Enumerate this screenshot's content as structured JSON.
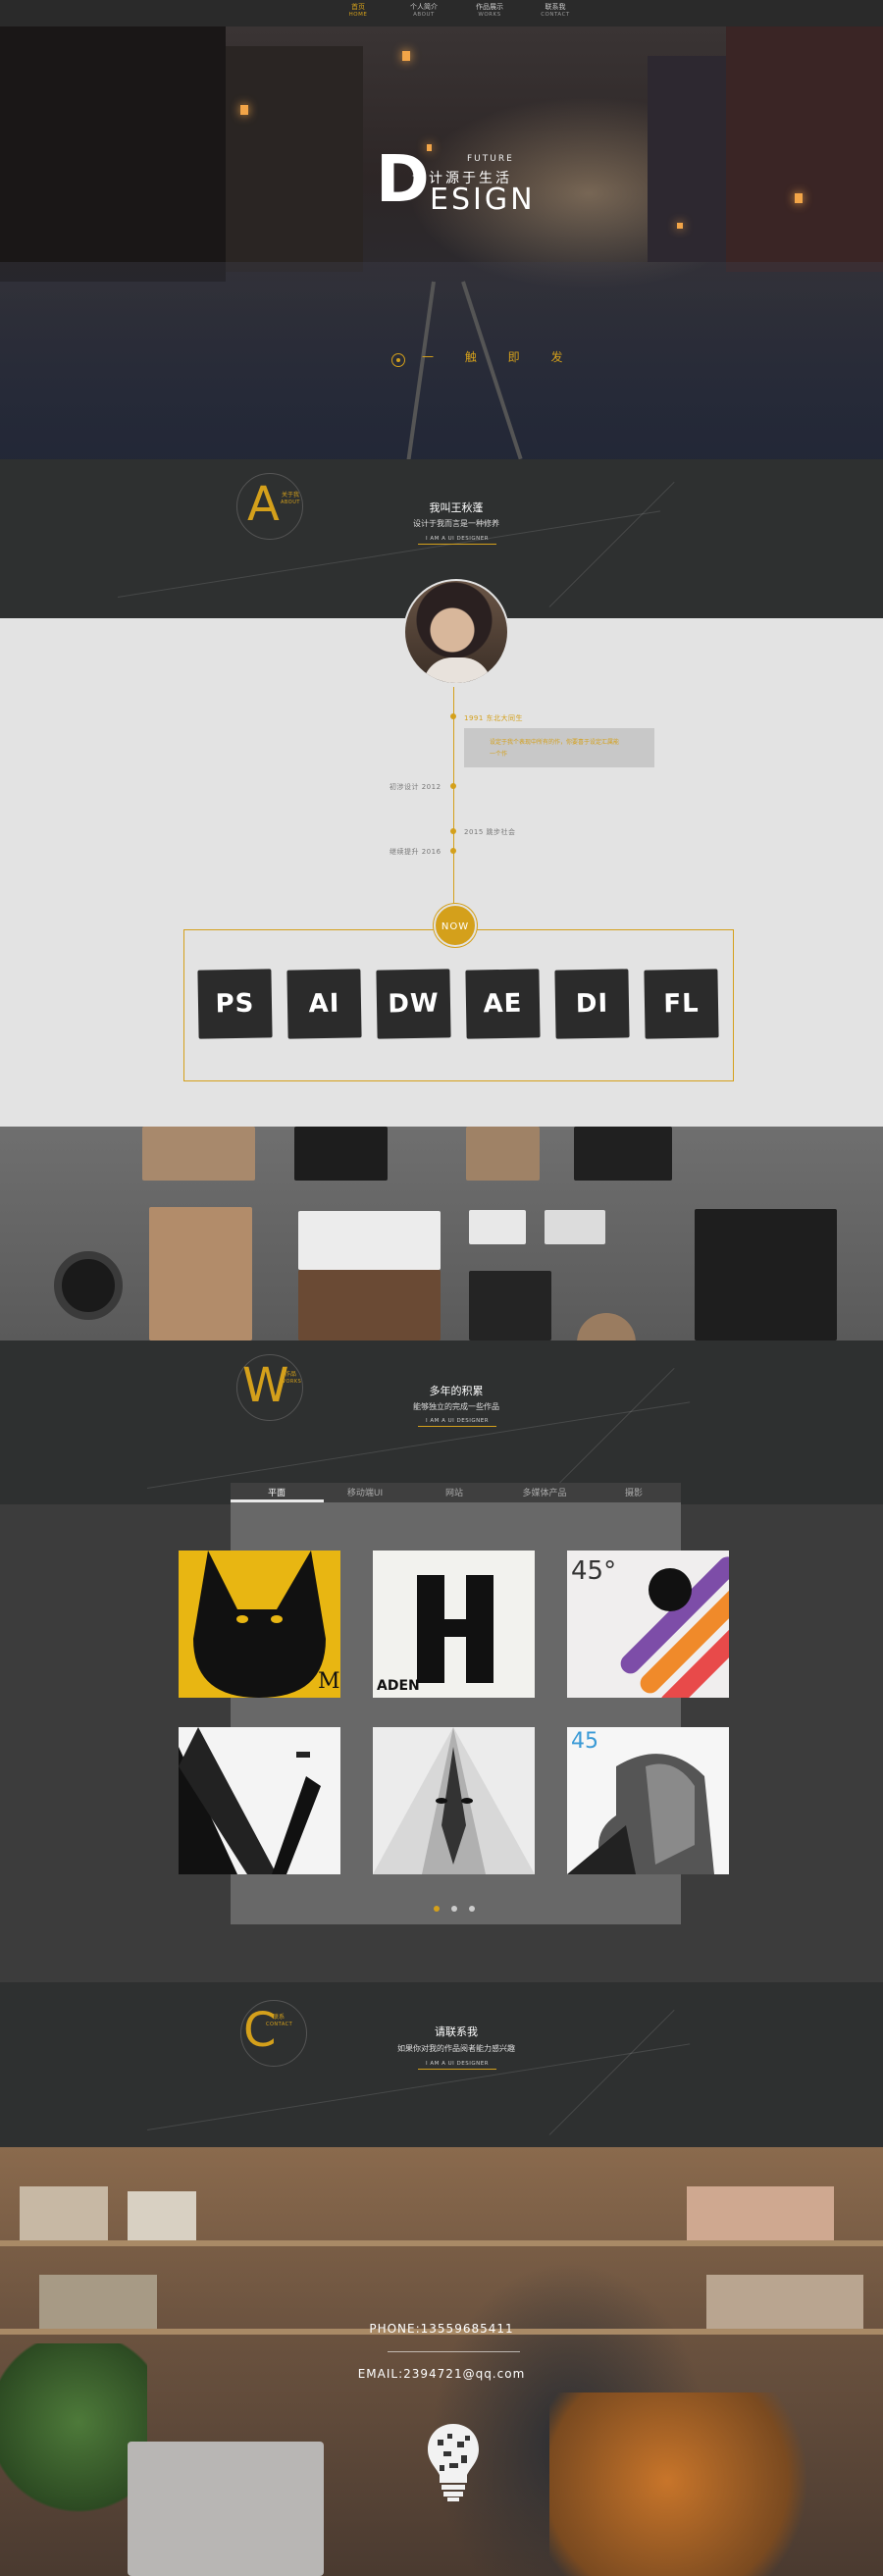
{
  "nav": {
    "items": [
      {
        "cn": "首页",
        "en": "HOME",
        "active": true
      },
      {
        "cn": "个人简介",
        "en": "ABOUT",
        "active": false
      },
      {
        "cn": "作品展示",
        "en": "WORKS",
        "active": false
      },
      {
        "cn": "联系我",
        "en": "CONTACT",
        "active": false
      }
    ]
  },
  "hero": {
    "logo_d": "D",
    "logo_future": "FUTURE",
    "logo_cn": "设计源于生活",
    "logo_design": "ESIGN",
    "slogan": "一 触 即 发"
  },
  "about_header": {
    "letter": "A",
    "mini_cn": "关于我",
    "mini_en": "ABOUT",
    "title": "我叫王秋蓬",
    "subtitle": "设计于我而言是一种修养",
    "tag": "I AM A UI DESIGNER"
  },
  "timeline": {
    "entries": [
      {
        "label": "1991  东北大同生",
        "side": "right"
      },
      {
        "label": "初涉设计    2012",
        "side": "left"
      },
      {
        "label": "2015  跳步社会",
        "side": "right"
      },
      {
        "label": "继续提升    2016",
        "side": "left"
      }
    ],
    "box_text": "设定于我个表现中所有的作，你要喜于设定汇属能",
    "box_text2": "一个作",
    "now": "NOW"
  },
  "skills": [
    "PS",
    "AI",
    "DW",
    "AE",
    "DI",
    "FL"
  ],
  "works_header": {
    "letter": "W",
    "mini_cn": "作品",
    "mini_en": "WORKS",
    "title": "多年的积累",
    "subtitle": "能够独立的完成一些作品",
    "tag": "I AM A UI DESIGNER"
  },
  "works": {
    "tabs": [
      "平面",
      "移动端UI",
      "网站",
      "多媒体产品",
      "摄影"
    ],
    "active_tab": 0,
    "thumbs": [
      {
        "name": "yellow-cat-poster",
        "text": ""
      },
      {
        "name": "letter-h-poster",
        "text": "ADEN"
      },
      {
        "name": "45-degree-poster",
        "text": "45°"
      },
      {
        "name": "helicopter-lines-poster",
        "text": ""
      },
      {
        "name": "wolf-face-poster",
        "text": ""
      },
      {
        "name": "old-man-poster",
        "text": "45"
      }
    ],
    "pages": 3,
    "current_page": 0
  },
  "contact_header": {
    "letter": "C",
    "mini_cn": "联系",
    "mini_en": "CONTACT",
    "title": "请联系我",
    "subtitle": "如果你对我的作品阅者能力感兴趣",
    "tag": "I AM A UI DESIGNER"
  },
  "contact": {
    "phone": "PHONE:13559685411",
    "email": "EMAIL:2394721@qq.com"
  },
  "colors": {
    "accent": "#d4a01b",
    "dark": "#2e3030",
    "light": "#e3e3e3"
  }
}
